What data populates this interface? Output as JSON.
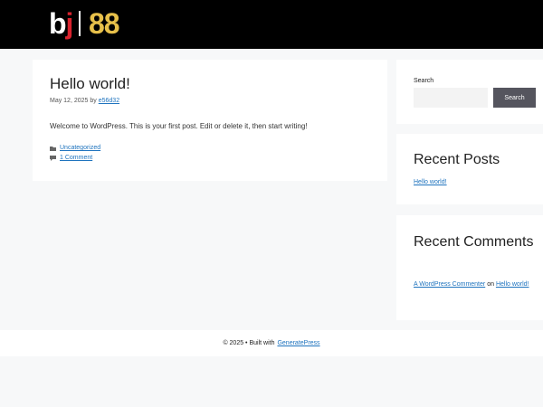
{
  "header": {
    "logo_letters": "bj",
    "logo_number": "88"
  },
  "post": {
    "title": "Hello world!",
    "date": "May 12, 2025",
    "by": "by",
    "author": "e56d32",
    "body": "Welcome to WordPress. This is your first post. Edit or delete it, then start writing!",
    "category": "Uncategorized",
    "comments_link": "1 Comment"
  },
  "search_widget": {
    "label": "Search",
    "input_value": "",
    "button_label": "Search"
  },
  "recent_posts": {
    "title": "Recent Posts",
    "items": [
      "Hello world!"
    ]
  },
  "recent_comments": {
    "title": "Recent Comments",
    "author": "A WordPress Commenter",
    "on": "on",
    "post": "Hello world!"
  },
  "footer": {
    "text": "© 2025 • Built with",
    "link": "GeneratePress"
  },
  "colors": {
    "header_bg": "#000000",
    "logo_gold": "#e7c04a",
    "logo_red": "#d9232e",
    "link": "#1e73be",
    "button_bg": "#55555e",
    "page_bg": "#f7f8f9"
  }
}
